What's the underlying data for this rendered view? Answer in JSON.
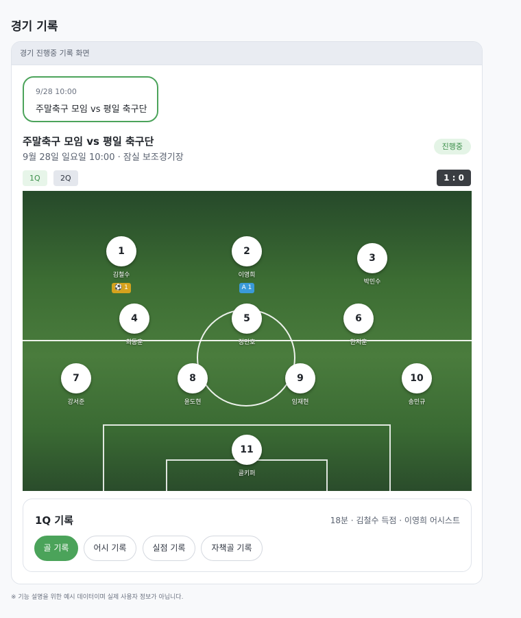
{
  "page": {
    "title": "경기 기록"
  },
  "card": {
    "header": "경기 진행중 기록 화면"
  },
  "match_chip": {
    "time": "9/28 10:00",
    "title": "주말축구 모임 vs 평일 축구단"
  },
  "match": {
    "title": "주말축구 모임 vs 평일 축구단",
    "meta": "9월 28일 일요일 10:00 · 잠실 보조경기장",
    "status": "진행중",
    "score": "1 : 0"
  },
  "quarters": [
    {
      "label": "1Q",
      "selected": true
    },
    {
      "label": "2Q",
      "selected": false
    }
  ],
  "players": [
    {
      "number": "1",
      "name": "김철수",
      "stat": "⚽ 1",
      "stat_type": "goal"
    },
    {
      "number": "2",
      "name": "이영희",
      "stat": "A 1",
      "stat_type": "assist"
    },
    {
      "number": "3",
      "name": "박민수"
    },
    {
      "number": "4",
      "name": "최동훈"
    },
    {
      "number": "5",
      "name": "정민호"
    },
    {
      "number": "6",
      "name": "한지훈"
    },
    {
      "number": "7",
      "name": "강서준"
    },
    {
      "number": "8",
      "name": "윤도현"
    },
    {
      "number": "9",
      "name": "임재현"
    },
    {
      "number": "10",
      "name": "송민규"
    },
    {
      "number": "11",
      "name": "골키퍼"
    }
  ],
  "record": {
    "title": "1Q 기록",
    "summary": "18분 · 김철수 득점 · 이영희 어시스트",
    "actions": [
      "골 기록",
      "어시 기록",
      "실점 기록",
      "자책골 기록"
    ],
    "active_action": "골 기록"
  },
  "footer": {
    "disclaimer": "※ 기능 설명을 위한 예시 데이터이며 실제 사용자 정보가 아닙니다."
  },
  "colors": {
    "accent": "#4ba35a",
    "goal": "#d5a21d",
    "assist": "#3a9ad9",
    "score_bg": "#3a3d42"
  }
}
